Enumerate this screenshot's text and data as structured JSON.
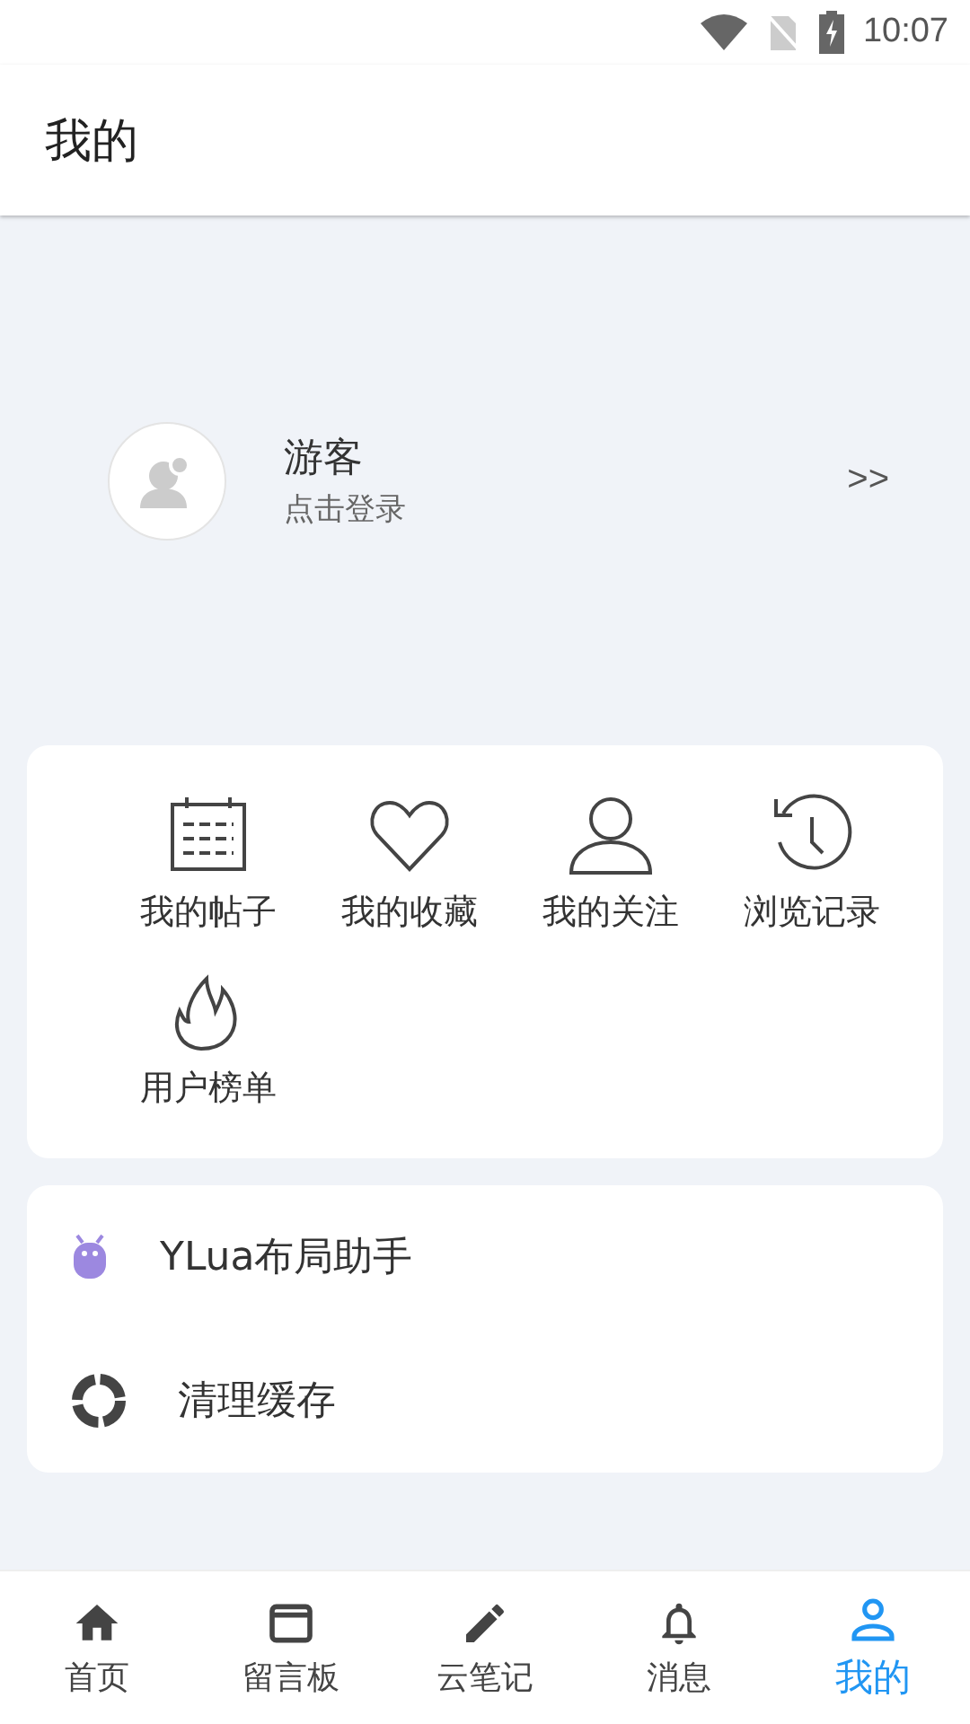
{
  "status_bar": {
    "time": "10:07"
  },
  "header": {
    "title": "我的"
  },
  "profile": {
    "name": "游客",
    "subtitle": "点击登录",
    "arrow": ">>"
  },
  "shortcuts": [
    {
      "kind": "calendar",
      "label": "我的帖子"
    },
    {
      "kind": "heart",
      "label": "我的收藏"
    },
    {
      "kind": "person",
      "label": "我的关注"
    },
    {
      "kind": "history",
      "label": "浏览记录"
    },
    {
      "kind": "flame",
      "label": "用户榜单"
    }
  ],
  "menu": [
    {
      "kind": "robot",
      "label": "YLua布局助手"
    },
    {
      "kind": "ring",
      "label": "清理缓存"
    }
  ],
  "bottom_nav": [
    {
      "kind": "home",
      "label": "首页",
      "selected": false
    },
    {
      "kind": "window",
      "label": "留言板",
      "selected": false
    },
    {
      "kind": "pencil",
      "label": "云笔记",
      "selected": false
    },
    {
      "kind": "bell",
      "label": "消息",
      "selected": false
    },
    {
      "kind": "user",
      "label": "我的",
      "selected": true
    }
  ]
}
